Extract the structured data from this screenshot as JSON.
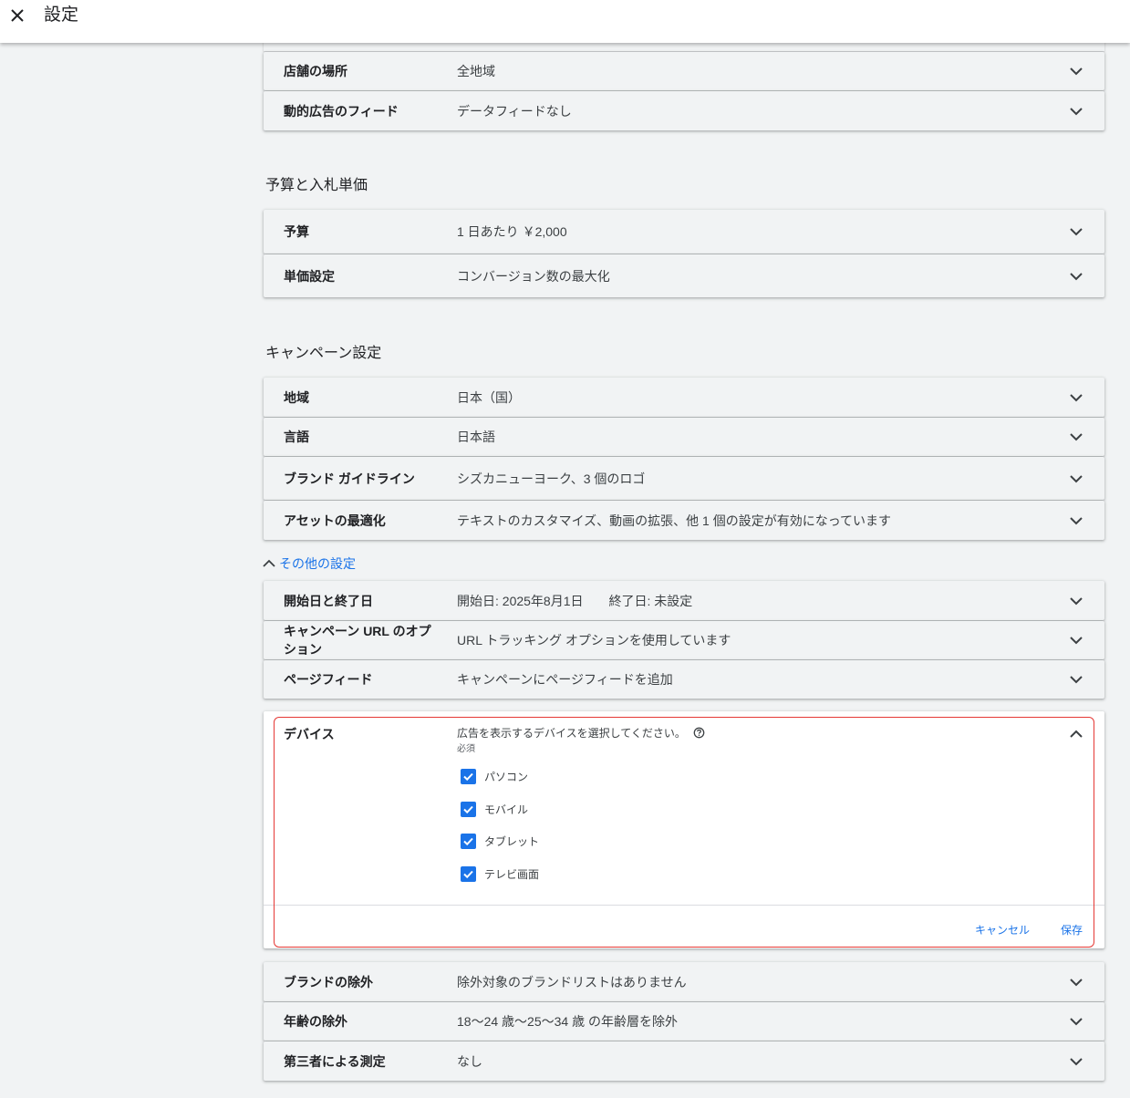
{
  "header": {
    "title": "設定"
  },
  "top_rows": [
    {
      "label": "店舗の場所",
      "value": "全地域"
    },
    {
      "label": "動的広告のフィード",
      "value": "データフィードなし"
    }
  ],
  "budget_section": {
    "title": "予算と入札単価",
    "rows": [
      {
        "label": "予算",
        "value": "1 日あたり ￥2,000"
      },
      {
        "label": "単価設定",
        "value": "コンバージョン数の最大化"
      }
    ]
  },
  "campaign_section": {
    "title": "キャンペーン設定",
    "rows": [
      {
        "label": "地域",
        "value": "日本（国）"
      },
      {
        "label": "言語",
        "value": "日本語"
      },
      {
        "label": "ブランド ガイドライン",
        "value": "シズカニューヨーク、3 個のロゴ"
      },
      {
        "label": "アセットの最適化",
        "value": "テキストのカスタマイズ、動画の拡張、他 1 個の設定が有効になっています"
      }
    ]
  },
  "more_settings": {
    "link_label": "その他の設定",
    "rows_before": [
      {
        "label": "開始日と終了日",
        "value": "開始日: 2025年8月1日　　終了日: 未設定"
      },
      {
        "label": "キャンペーン URL のオプション",
        "value": "URL トラッキング オプションを使用しています"
      },
      {
        "label": "ページフィード",
        "value": "キャンペーンにページフィードを追加"
      }
    ],
    "device": {
      "label": "デバイス",
      "description": "広告を表示するデバイスを選択してください。",
      "required": "必須",
      "options": [
        {
          "label": "パソコン",
          "checked": true
        },
        {
          "label": "モバイル",
          "checked": true
        },
        {
          "label": "タブレット",
          "checked": true
        },
        {
          "label": "テレビ画面",
          "checked": true
        }
      ],
      "cancel_label": "キャンセル",
      "save_label": "保存"
    },
    "rows_after": [
      {
        "label": "ブランドの除外",
        "value": "除外対象のブランドリストはありません"
      },
      {
        "label": "年齢の除外",
        "value": "18〜24 歳〜25〜34 歳 の年齢層を除外"
      },
      {
        "label": "第三者による測定",
        "value": "なし"
      }
    ]
  },
  "colors": {
    "accent": "#1a73e8",
    "highlight": "#e53935",
    "background": "#f1f3f4"
  }
}
